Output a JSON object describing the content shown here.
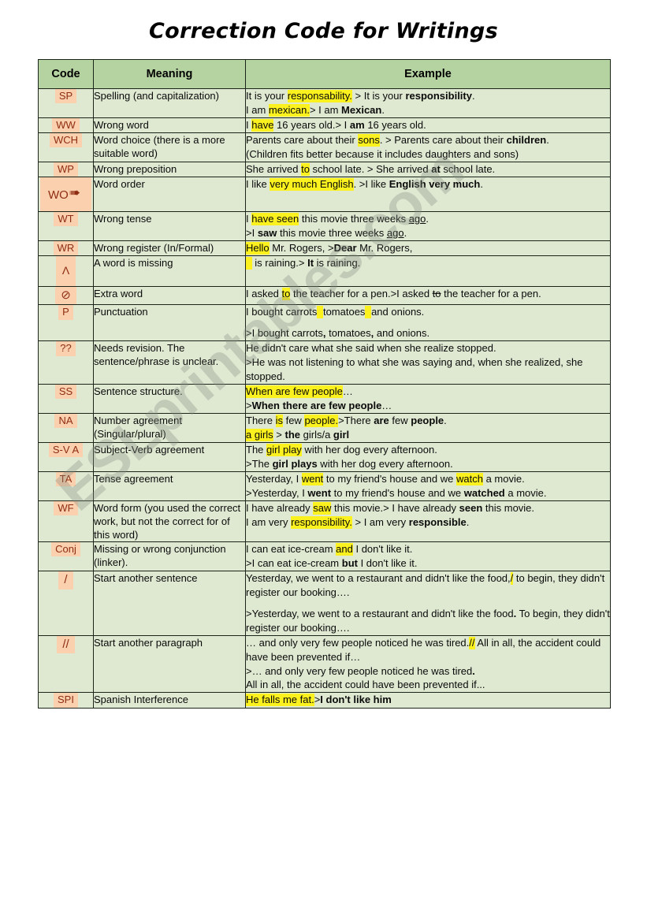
{
  "title": "Correction Code for Writings",
  "watermark": "ESLprintables.com",
  "colors": {
    "header_green": "#b5d3a0",
    "cell_green": "#dfe9d2",
    "code_chip_peach": "#fad0ae",
    "code_text": "#8f2d12",
    "highlight_yellow": "#fbf11e",
    "border": "#1a2418"
  },
  "table": {
    "headers": [
      "Code",
      "Meaning",
      "Example"
    ],
    "rows": [
      {
        "code": "SP",
        "meaning": "Spelling (and capitalization)",
        "example_lines": [
          "It is your responsability. > It is your responsibility.",
          "I am mexican.> I am Mexican."
        ]
      },
      {
        "code": "WW",
        "meaning": "Wrong word",
        "example_lines": [
          "I have 16 years old.> I am 16 years old."
        ]
      },
      {
        "code": "WCH",
        "meaning": "Word choice (there is a more suitable word)",
        "example_lines": [
          "Parents care about their sons. > Parents care about their children.",
          "(Children fits better because it includes daughters and sons)"
        ]
      },
      {
        "code": "WP",
        "meaning": "Wrong preposition",
        "example_lines": [
          "She arrived to school late. > She arrived at school late."
        ]
      },
      {
        "code": "WO",
        "meaning": "Word order",
        "example_lines": [
          "I like very much English. >I like English very much."
        ]
      },
      {
        "code": "WT",
        "meaning": "Wrong tense",
        "example_lines": [
          "I have seen this movie three weeks ago.",
          ">I saw this movie three weeks ago."
        ]
      },
      {
        "code": "WR",
        "meaning": "Wrong register (In/Formal)",
        "example_lines": [
          "Hello Mr. Rogers, >Dear Mr. Rogers,"
        ]
      },
      {
        "code": "Λ",
        "meaning": "A word is missing",
        "example_lines": [
          " is raining.> It is raining."
        ]
      },
      {
        "code": "⊘",
        "meaning": "Extra word",
        "example_lines": [
          "I asked to the teacher for a pen.>I asked to the teacher for a pen."
        ]
      },
      {
        "code": "P",
        "meaning": "Punctuation",
        "example_lines": [
          "I bought carrots tomatoes and onions.",
          ">I bought carrots, tomatoes, and onions."
        ]
      },
      {
        "code": "??",
        "meaning": "Needs revision. The sentence/phrase is unclear.",
        "example_lines": [
          "He didn't care what she said when she realize stopped.",
          ">He was not listening to what she was saying and, when she realized, she stopped."
        ]
      },
      {
        "code": "SS",
        "meaning": "Sentence structure.",
        "example_lines": [
          "When are few people…",
          ">When there are few people…"
        ]
      },
      {
        "code": "NA",
        "meaning": "Number agreement (Singular/plural)",
        "example_lines": [
          "There is few people.>There are few people.",
          "a girls > the girls/a girl"
        ]
      },
      {
        "code": "S-V A",
        "meaning": "Subject-Verb agreement",
        "example_lines": [
          "The girl play with her dog every afternoon.",
          ">The girl plays with her dog every afternoon."
        ]
      },
      {
        "code": "TA",
        "meaning": "Tense agreement",
        "example_lines": [
          "Yesterday, I went to my friend's house and we watch a movie.",
          ">Yesterday, I went to my friend's house and we watched a movie."
        ]
      },
      {
        "code": "WF",
        "meaning": "Word form (you used the correct work, but not the correct for of this word)",
        "example_lines": [
          "I have already saw this movie.> I have already seen this movie.",
          "I am very responsibility. > I am very responsible."
        ]
      },
      {
        "code": "Conj",
        "meaning": "Missing or wrong conjunction (linker).",
        "example_lines": [
          "I can eat ice-cream and I don't like it.",
          ">I can eat ice-cream but I don't like it."
        ]
      },
      {
        "code": "/",
        "meaning": "Start another sentence",
        "example_lines": [
          "Yesterday, we went to a restaurant and didn't like the food,/ to begin, they didn't register our booking….",
          ">Yesterday, we went to a restaurant and didn't like the food. To begin, they didn't register our booking…."
        ]
      },
      {
        "code": "//",
        "meaning": "Start another paragraph",
        "example_lines": [
          "… and only very few people noticed he was tired.// All in all, the accident could have been prevented if…",
          ">… and only very few people noticed he was tired.",
          "All in all, the accident could have been prevented if..."
        ]
      },
      {
        "code": "SPI",
        "meaning": "Spanish Interference",
        "example_lines": [
          "He falls me fat.>I don't like him"
        ]
      }
    ]
  }
}
